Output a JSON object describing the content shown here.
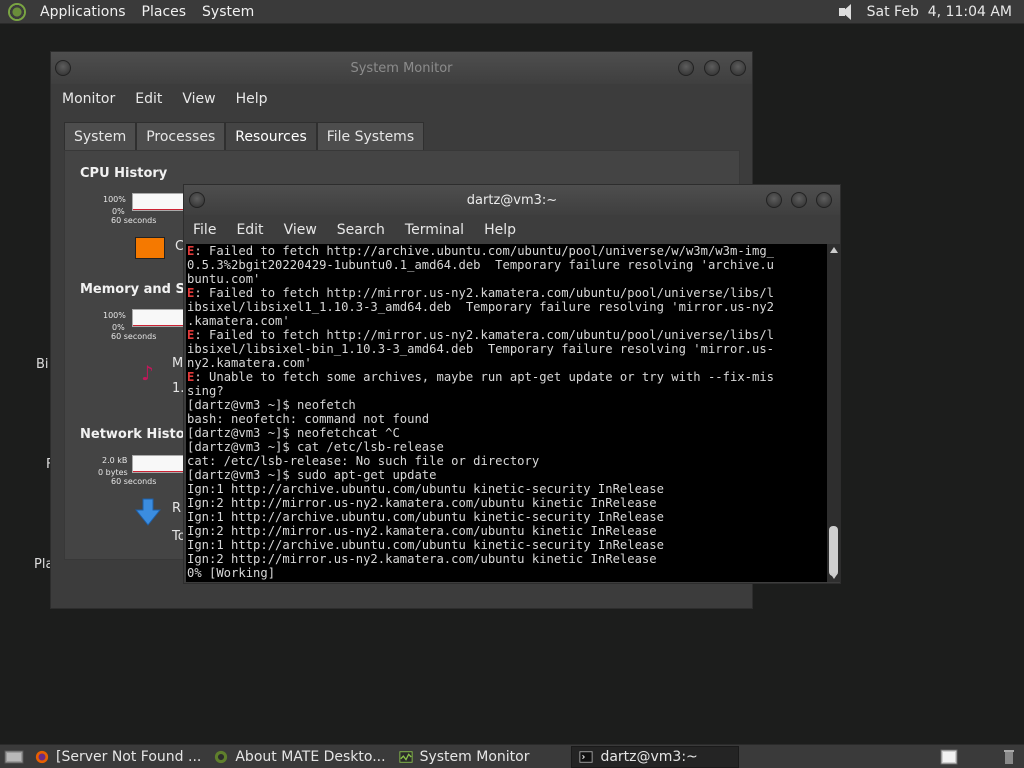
{
  "top_panel": {
    "menus": [
      "Applications",
      "Places",
      "System"
    ],
    "clock": "Sat Feb  4, 11:04 AM"
  },
  "desktop": {
    "labels": [
      "Bi",
      "F",
      "Pla"
    ]
  },
  "sysmon": {
    "title": "System Monitor",
    "menu": [
      "Monitor",
      "Edit",
      "View",
      "Help"
    ],
    "tabs": [
      "System",
      "Processes",
      "Resources",
      "File Systems"
    ],
    "active_tab": "Resources",
    "cpu": {
      "title": "CPU History",
      "top": "100%",
      "bottom": "0%",
      "span": "60 seconds",
      "legend": "C"
    },
    "memory": {
      "title": "Memory and Swa",
      "top": "100%",
      "bottom": "0%",
      "span": "60 seconds",
      "legend_m": "M",
      "legend_val": "1."
    },
    "network": {
      "title": "Network History",
      "top": "2.0 kB",
      "bottom": "0 bytes",
      "span": "60 seconds",
      "legend_r": "R",
      "legend_t": "To"
    },
    "colors": {
      "cpu_swatch": "#f57900"
    }
  },
  "terminal": {
    "title": "dartz@vm3:~",
    "menu": [
      "File",
      "Edit",
      "View",
      "Search",
      "Terminal",
      "Help"
    ],
    "lines": [
      {
        "err": "E",
        "text": ": Failed to fetch http://archive.ubuntu.com/ubuntu/pool/universe/w/w3m/w3m-img_"
      },
      {
        "err": "",
        "text": "0.5.3%2bgit20220429-1ubuntu0.1_amd64.deb  Temporary failure resolving 'archive.u"
      },
      {
        "err": "",
        "text": "buntu.com'"
      },
      {
        "err": "E",
        "text": ": Failed to fetch http://mirror.us-ny2.kamatera.com/ubuntu/pool/universe/libs/l"
      },
      {
        "err": "",
        "text": "ibsixel/libsixel1_1.10.3-3_amd64.deb  Temporary failure resolving 'mirror.us-ny2"
      },
      {
        "err": "",
        "text": ".kamatera.com'"
      },
      {
        "err": "E",
        "text": ": Failed to fetch http://mirror.us-ny2.kamatera.com/ubuntu/pool/universe/libs/l"
      },
      {
        "err": "",
        "text": "ibsixel/libsixel-bin_1.10.3-3_amd64.deb  Temporary failure resolving 'mirror.us-"
      },
      {
        "err": "",
        "text": "ny2.kamatera.com'"
      },
      {
        "err": "E",
        "text": ": Unable to fetch some archives, maybe run apt-get update or try with --fix-mis"
      },
      {
        "err": "",
        "text": "sing?"
      },
      {
        "err": "",
        "text": "[dartz@vm3 ~]$ neofetch"
      },
      {
        "err": "",
        "text": "bash: neofetch: command not found"
      },
      {
        "err": "",
        "text": "[dartz@vm3 ~]$ neofetchcat ^C"
      },
      {
        "err": "",
        "text": "[dartz@vm3 ~]$ cat /etc/lsb-release"
      },
      {
        "err": "",
        "text": "cat: /etc/lsb-release: No such file or directory"
      },
      {
        "err": "",
        "text": "[dartz@vm3 ~]$ sudo apt-get update"
      },
      {
        "err": "",
        "text": "Ign:1 http://archive.ubuntu.com/ubuntu kinetic-security InRelease"
      },
      {
        "err": "",
        "text": "Ign:2 http://mirror.us-ny2.kamatera.com/ubuntu kinetic InRelease"
      },
      {
        "err": "",
        "text": "Ign:1 http://archive.ubuntu.com/ubuntu kinetic-security InRelease"
      },
      {
        "err": "",
        "text": "Ign:2 http://mirror.us-ny2.kamatera.com/ubuntu kinetic InRelease"
      },
      {
        "err": "",
        "text": "Ign:1 http://archive.ubuntu.com/ubuntu kinetic-security InRelease"
      },
      {
        "err": "",
        "text": "Ign:2 http://mirror.us-ny2.kamatera.com/ubuntu kinetic InRelease"
      },
      {
        "err": "",
        "text": "0% [Working]"
      }
    ],
    "colors": {
      "error": "#e23a3a",
      "text": "#d8d8d8",
      "background": "#000000"
    }
  },
  "taskbar": {
    "tasks": [
      {
        "label": "[Server Not Found ...",
        "icon": "firefox-icon"
      },
      {
        "label": "About MATE Deskto...",
        "icon": "mate-icon"
      },
      {
        "label": "System Monitor",
        "icon": "system-monitor-icon"
      },
      {
        "label": "dartz@vm3:~",
        "icon": "terminal-icon",
        "active": true
      }
    ]
  }
}
